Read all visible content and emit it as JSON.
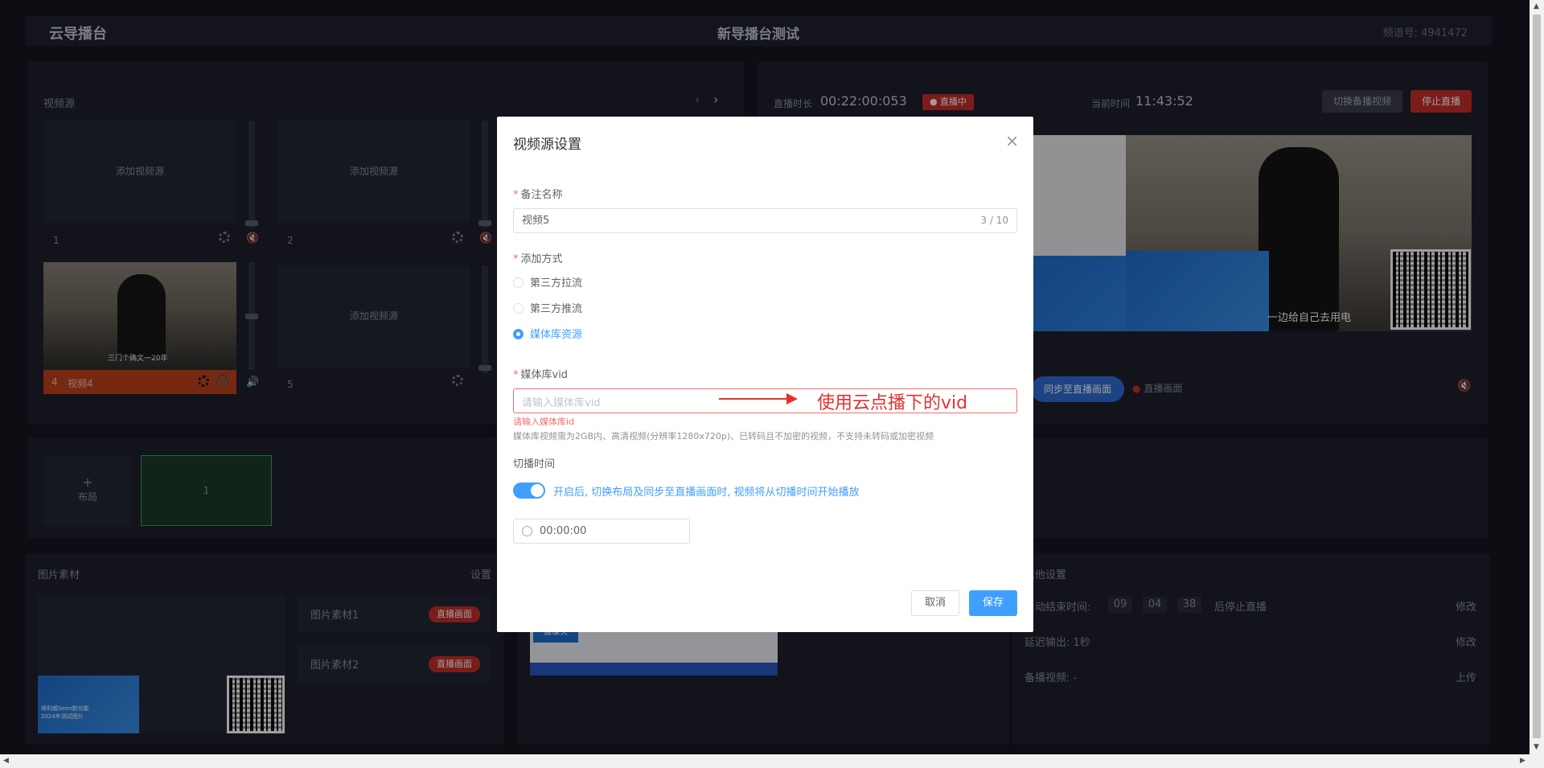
{
  "header": {
    "brand": "云导播台",
    "title": "新导播台测试",
    "channel": "频道号: 4941472"
  },
  "video_source": {
    "title": "视频源",
    "tiles": [
      {
        "label": "添加视频源",
        "index": "1"
      },
      {
        "label": "添加视频源",
        "index": "2"
      },
      {
        "label": "添加视频源",
        "index": "5"
      }
    ],
    "active_tile": {
      "index": "4",
      "name": "视频4",
      "caption": "三门个确文一20年"
    }
  },
  "live": {
    "duration_label": "直播时长",
    "duration": "00:22:00:053",
    "status": "直播中",
    "time_label": "当前时间",
    "time": "11:43:52",
    "switch_backup": "切换备播视频",
    "stop": "停止直播",
    "sync_button": "同步至直播画面",
    "live_screen": "直播画面",
    "caption": "一边给自己去用电"
  },
  "layout": {
    "add_label": "布局",
    "add_icon": "+",
    "layout_item": "1"
  },
  "materials": {
    "title": "图片素材",
    "settings": "设置",
    "items": [
      {
        "name": "图片素材1",
        "badge": "直播画面"
      },
      {
        "name": "图片素材2",
        "badge": "直播画面"
      }
    ],
    "thumb_text1": "保利威Seen新功能",
    "thumb_text2": "2024年测试图片",
    "camera_label": "摄像头"
  },
  "other": {
    "title": "其他设置",
    "auto_end_label": "自动结束时间:",
    "h": "09",
    "m": "04",
    "s": "38",
    "auto_end_suffix": "后停止直播",
    "modify": "修改",
    "delay": "延迟输出: 1秒",
    "modify2": "修改",
    "backup": "备播视频: -",
    "upload": "上传"
  },
  "dialog": {
    "title": "视频源设置",
    "close": "×",
    "name_label": "备注名称",
    "name_value": "视频5",
    "name_counter": "3 / 10",
    "method_label": "添加方式",
    "methods": [
      "第三方拉流",
      "第三方推流",
      "媒体库资源"
    ],
    "selected_method": "媒体库资源",
    "vid_label": "媒体库vid",
    "vid_placeholder": "请输入媒体库vid",
    "vid_error": "请输入媒体库id",
    "vid_hint": "媒体库视频需为2GB内、高清视频(分辨率1280x720p)、已转码且不加密的视频，不支持未转码或加密视频",
    "switch_label": "切播时间",
    "switch_text": "开启后, 切换布局及同步至直播画面时, 视频将从切播时间开始播放",
    "time_value": "00:00:00",
    "cancel": "取消",
    "save": "保存"
  },
  "annotation": "使用云点播下的vid",
  "colors": {
    "accent": "#409eff",
    "danger": "#c6302b",
    "annotation": "#e53030"
  }
}
